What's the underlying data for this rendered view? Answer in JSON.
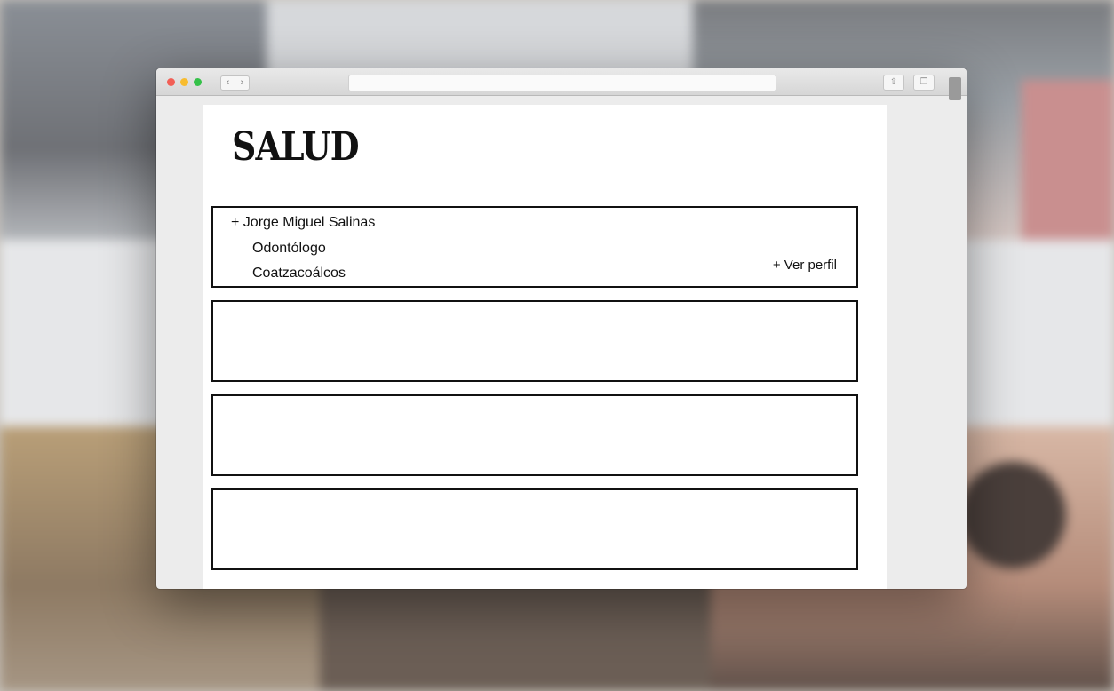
{
  "page": {
    "title": "SALUD"
  },
  "browser": {
    "back_glyph": "‹",
    "forward_glyph": "›",
    "share_glyph": "⇧",
    "tabs_glyph": "❐"
  },
  "profiles": [
    {
      "name": "+ Jorge Miguel Salinas",
      "specialty": "Odontólogo",
      "city": "Coatzacoálcos",
      "link_label": "+ Ver perfil"
    }
  ]
}
